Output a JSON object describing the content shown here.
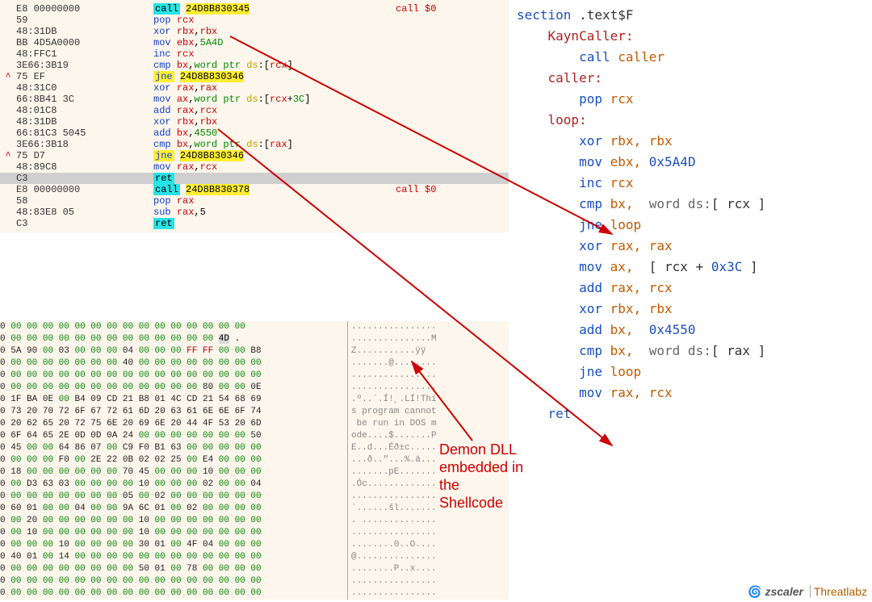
{
  "disasm": [
    {
      "mark": "",
      "bytes": "E8 00000000",
      "mn": "call",
      "ops": "24D8B830345",
      "hl": "call",
      "xref": "call $0"
    },
    {
      "mark": "",
      "bytes": "59",
      "mn": "pop",
      "ops": "rcx",
      "hl": "pop"
    },
    {
      "mark": "",
      "bytes": "48:31DB",
      "mn": "xor",
      "ops": "rbx,rbx",
      "hl": "xor"
    },
    {
      "mark": "",
      "bytes": "BB 4D5A0000",
      "mn": "mov",
      "ops": "ebx,5A4D",
      "hl": "mov"
    },
    {
      "mark": "",
      "bytes": "48:FFC1",
      "mn": "inc",
      "ops": "rcx",
      "hl": "inc"
    },
    {
      "mark": "",
      "bytes": "3E66:3B19",
      "mn": "cmp",
      "ops": "bx,word ptr ds:[rcx]",
      "hl": "cmp"
    },
    {
      "mark": "^",
      "bytes": "75 EF",
      "mn": "jne",
      "ops": "24D8B830346",
      "hl": "jne"
    },
    {
      "mark": "",
      "bytes": "48:31C0",
      "mn": "xor",
      "ops": "rax,rax",
      "hl": "xor"
    },
    {
      "mark": "",
      "bytes": "66:8B41 3C",
      "mn": "mov",
      "ops": "ax,word ptr ds:[rcx+3C]",
      "hl": "mov"
    },
    {
      "mark": "",
      "bytes": "48:01C8",
      "mn": "add",
      "ops": "rax,rcx",
      "hl": "add"
    },
    {
      "mark": "",
      "bytes": "48:31DB",
      "mn": "xor",
      "ops": "rbx,rbx",
      "hl": "xor"
    },
    {
      "mark": "",
      "bytes": "66:81C3 5045",
      "mn": "add",
      "ops": "bx,4550",
      "hl": "add"
    },
    {
      "mark": "",
      "bytes": "3E66:3B18",
      "mn": "cmp",
      "ops": "bx,word ptr ds:[rax]",
      "hl": "cmp"
    },
    {
      "mark": "^",
      "bytes": "75 D7",
      "mn": "jne",
      "ops": "24D8B830346",
      "hl": "jne"
    },
    {
      "mark": "",
      "bytes": "48:89C8",
      "mn": "mov",
      "ops": "rax,rcx",
      "hl": "mov"
    },
    {
      "mark": "",
      "bytes": "C3",
      "mn": "ret",
      "ops": "",
      "hl": "ret",
      "grey": true
    },
    {
      "mark": "",
      "bytes": "E8 00000000",
      "mn": "call",
      "ops": "24D8B830378",
      "hl": "call",
      "xref": "call $0"
    },
    {
      "mark": "",
      "bytes": "58",
      "mn": "pop",
      "ops": "rax",
      "hl": "pop"
    },
    {
      "mark": "",
      "bytes": "48:83E8 05",
      "mn": "sub",
      "ops": "rax,5",
      "hl": "sub"
    },
    {
      "mark": "",
      "bytes": "C3",
      "mn": "ret",
      "ops": "",
      "hl": "ret"
    }
  ],
  "source": [
    {
      "indent": 0,
      "kw": "section",
      "rest": " .text$F"
    },
    {
      "indent": 1,
      "lbl": "KaynCaller:"
    },
    {
      "indent": 2,
      "kw": "call",
      "reg": " caller"
    },
    {
      "indent": 1,
      "lbl": "caller:"
    },
    {
      "indent": 2,
      "kw": "pop",
      "reg": " rcx"
    },
    {
      "indent": 1,
      "lbl": "loop:"
    },
    {
      "indent": 2,
      "kw": "xor",
      "reg": " rbx, rbx"
    },
    {
      "indent": 2,
      "kw": "mov",
      "reg": " ebx,",
      "imm": " 0x5A4D"
    },
    {
      "indent": 2,
      "kw": "inc",
      "reg": " rcx"
    },
    {
      "indent": 2,
      "kw": "cmp",
      "reg": " bx,  ",
      "ds": "word ds:",
      "tail": "[ rcx ]"
    },
    {
      "indent": 2,
      "kw": "jne",
      "reg": " loop"
    },
    {
      "indent": 2,
      "kw": "xor",
      "reg": " rax, rax"
    },
    {
      "indent": 2,
      "kw": "mov",
      "reg": " ax,  ",
      "tail": "[ rcx + ",
      "imm": "0x3C",
      "tail2": " ]"
    },
    {
      "indent": 2,
      "kw": "add",
      "reg": " rax, rcx"
    },
    {
      "indent": 2,
      "kw": "xor",
      "reg": " rbx, rbx"
    },
    {
      "indent": 2,
      "kw": "add",
      "reg": " bx,  ",
      "imm": "0x4550"
    },
    {
      "indent": 2,
      "kw": "cmp",
      "reg": " bx,  ",
      "ds": "word ds:",
      "tail": "[ rax ]"
    },
    {
      "indent": 2,
      "kw": "jne",
      "reg": " loop"
    },
    {
      "indent": 2,
      "kw": "mov",
      "reg": " rax, rcx"
    },
    {
      "indent": 1,
      "kw": "ret"
    }
  ],
  "hex": [
    {
      "h": "0 00 00 00 00 00 00 00 00 00 00 00 00 00 00 00",
      "a": "................"
    },
    {
      "h": "0 00 00 00 00 00 00 00 00 00 00 00 00 00 4D .",
      "a": "...............M",
      "mz": true
    },
    {
      "h": "0 5A 90 00 03 00 00 00 04 00 00 00 FF FF 00 00 B8",
      "a": "Z...........ÿÿ"
    },
    {
      "h": "0 00 00 00 00 00 00 00 40 00 00 00 00 00 00 00 00",
      "a": ".......@........"
    },
    {
      "h": "0 00 00 00 00 00 00 00 00 00 00 00 00 00 00 00 00",
      "a": "................"
    },
    {
      "h": "0 00 00 00 00 00 00 00 00 00 00 00 00 80 00 00 0E",
      "a": "................"
    },
    {
      "h": "0 1F BA 0E 00 B4 09 CD 21 B8 01 4C CD 21 54 68 69",
      "a": ".º..´.Í!¸.LÍ!Thi"
    },
    {
      "h": "0 73 20 70 72 6F 67 72 61 6D 20 63 61 6E 6E 6F 74",
      "a": "s program cannot"
    },
    {
      "h": "0 20 62 65 20 72 75 6E 20 69 6E 20 44 4F 53 20 6D",
      "a": " be run in DOS m"
    },
    {
      "h": "0 6F 64 65 2E 0D 0D 0A 24 00 00 00 00 00 00 00 50",
      "a": "ode....$.......P"
    },
    {
      "h": "0 45 00 00 64 86 07 00 C9 F0 B1 63 00 00 00 00 00",
      "a": "E..d...Éð±c....."
    },
    {
      "h": "0 00 00 00 F0 00 2E 22 0B 02 02 25 00 E4 00 00 00",
      "a": "...ð..\"...%.ä..."
    },
    {
      "h": "0 18 00 00 00 00 00 00 70 45 00 00 00 10 00 00 00",
      "a": ".......pE......."
    },
    {
      "h": "0 00 D3 63 03 00 00 00 00 10 00 00 00 02 00 00 04",
      "a": ".Óc............."
    },
    {
      "h": "0 00 00 00 00 00 00 00 05 00 02 00 00 00 00 00 00",
      "a": "................"
    },
    {
      "h": "0 60 01 00 00 04 00 00 9A 6C 01 00 02 00 00 00 00",
      "a": "`......šl......."
    },
    {
      "h": "0 00 20 00 00 00 00 00 00 10 00 00 00 00 00 00 00",
      "a": ". .............."
    },
    {
      "h": "0 00 10 00 00 00 00 00 00 10 00 00 00 00 00 00 00",
      "a": "................"
    },
    {
      "h": "0 00 00 00 10 00 00 00 00 30 01 00 4F 04 00 00 00",
      "a": "........0..O...."
    },
    {
      "h": "0 40 01 00 14 00 00 00 00 00 00 00 00 00 00 00 00",
      "a": "@..............."
    },
    {
      "h": "0 00 00 00 00 00 00 00 00 50 01 00 78 00 00 00 00",
      "a": "........P..x...."
    },
    {
      "h": "0 00 00 00 00 00 00 00 00 00 00 00 00 00 00 00 00",
      "a": "................"
    },
    {
      "h": "0 00 00 00 00 00 00 00 00 00 00 00 00 00 00 00 00",
      "a": "................"
    }
  ],
  "annotation": {
    "l1": "Demon DLL",
    "l2": "embedded in",
    "l3": "the",
    "l4": "Shellcode"
  },
  "logo": {
    "zscaler": "zscaler",
    "threatlabz": "Threatlabz"
  }
}
